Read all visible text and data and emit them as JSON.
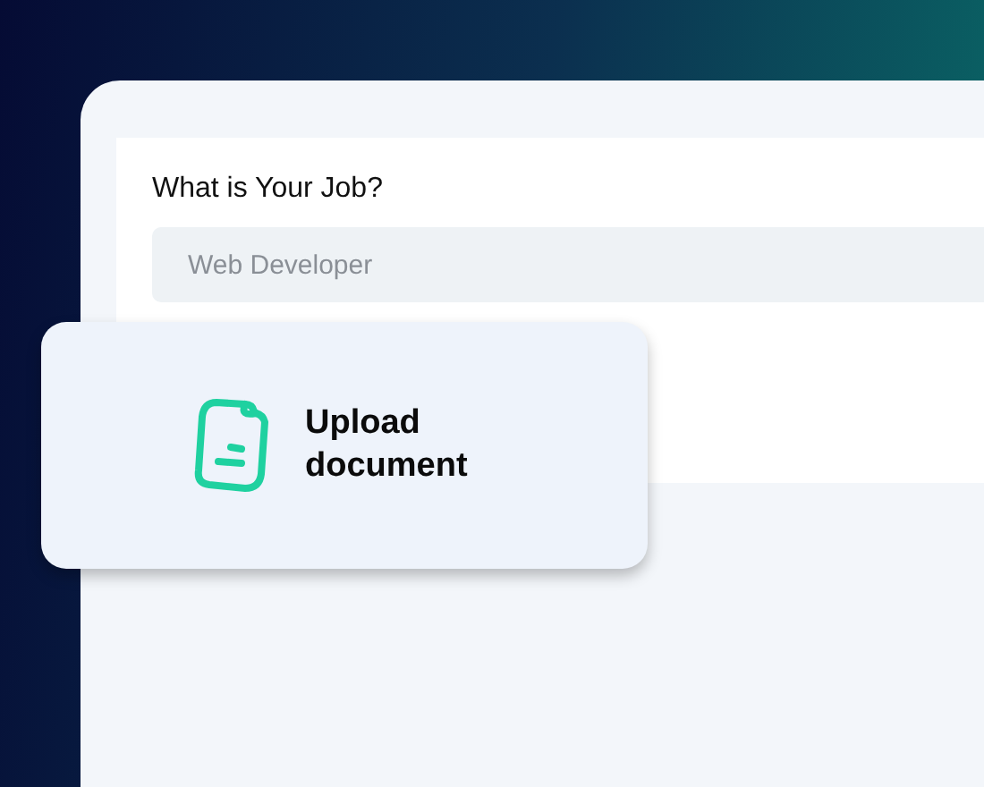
{
  "form": {
    "label": "What is Your Job?",
    "job_field": {
      "placeholder": "Web Developer"
    }
  },
  "upload_card": {
    "label": "Upload document"
  }
}
